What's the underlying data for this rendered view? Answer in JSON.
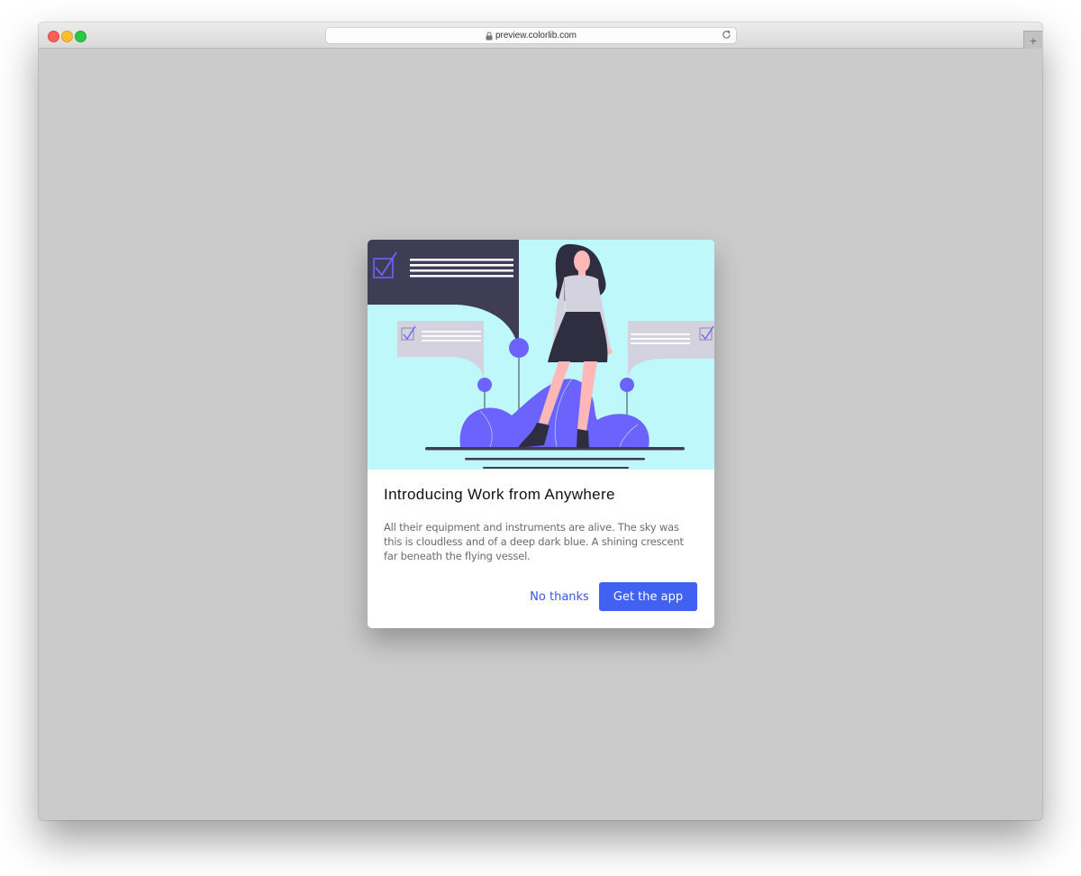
{
  "browser": {
    "url": "preview.colorlib.com",
    "new_tab_label": "+"
  },
  "modal": {
    "title": "Introducing Work from Anywhere",
    "body": "All their equipment and instruments are alive. The sky was this is cloudless and of a deep dark blue. A shining crescent far beneath the flying vessel.",
    "secondary_label": "No thanks",
    "primary_label": "Get the app"
  },
  "colors": {
    "page_backdrop": "#cbcbcb",
    "primary_button": "#4161f2",
    "link_text": "#3a55e4",
    "illustration_sky": "#bff8fa",
    "illustration_dark": "#3f3d56",
    "illustration_accent": "#6c63ff"
  }
}
